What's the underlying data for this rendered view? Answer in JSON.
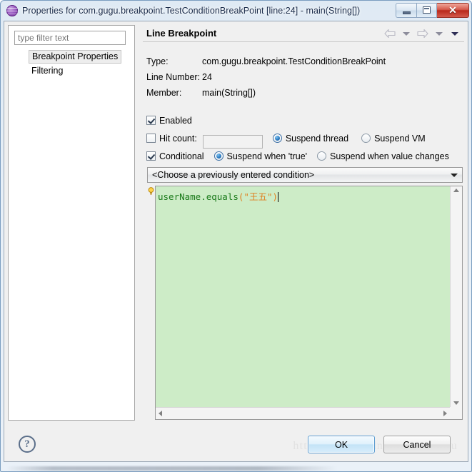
{
  "window": {
    "title": "Properties for com.gugu.breakpoint.TestConditionBreakPoint [line:24] - main(String[])",
    "icon": "eclipse-globe-icon",
    "buttons": {
      "minimize": "–",
      "maximize": "□",
      "close": "✕"
    }
  },
  "sidebar": {
    "filter": {
      "placeholder": "type filter text",
      "value": ""
    },
    "items": [
      {
        "label": "Breakpoint Properties",
        "selected": true
      },
      {
        "label": "Filtering",
        "selected": false
      }
    ]
  },
  "page": {
    "title": "Line Breakpoint",
    "nav": {
      "back": "back-arrow",
      "back_menu": "chevron-down",
      "forward": "forward-arrow",
      "forward_menu": "chevron-down",
      "view_menu": "chevron-down-filled"
    },
    "info": [
      {
        "label": "Type:",
        "value": "com.gugu.breakpoint.TestConditionBreakPoint"
      },
      {
        "label": "Line Number:",
        "value": "24"
      },
      {
        "label": "Member:",
        "value": "main(String[])"
      }
    ],
    "controls": {
      "enabled": {
        "label": "Enabled",
        "checked": true
      },
      "hit_count": {
        "label": "Hit count:",
        "checked": false,
        "value": ""
      },
      "suspend_thread": {
        "label": "Suspend thread",
        "selected": true
      },
      "suspend_vm": {
        "label": "Suspend VM",
        "selected": false
      },
      "conditional": {
        "label": "Conditional",
        "checked": true
      },
      "suspend_when_true": {
        "label": "Suspend when 'true'",
        "selected": true
      },
      "suspend_when_value_changes": {
        "label": "Suspend when value changes",
        "selected": false
      }
    },
    "condition_combo": {
      "value": "<Choose a previously entered condition>",
      "arrow": "chevron-down"
    },
    "editor": {
      "hint_icon": "lightbulb-icon",
      "code_tokens": [
        {
          "text": "userName.equals",
          "type": "id"
        },
        {
          "text": "(",
          "type": "punct"
        },
        {
          "text": "\"王五\"",
          "type": "str"
        },
        {
          "text": ")",
          "type": "punct"
        }
      ],
      "plain_code": "userName.equals(\"王五\")",
      "background": "#cdecc7"
    }
  },
  "footer": {
    "help": "?",
    "ok": "OK",
    "cancel": "Cancel",
    "watermark": "https://blog.csdn.net/zhazhagu"
  },
  "colors": {
    "titlebar_text": "#1b2c4a",
    "editor_bg": "#cdecc7",
    "code_identifier": "#1a7a1a",
    "code_punctuation": "#e08020",
    "radio_accent": "#2d7dc4",
    "ok_border": "#5a9bd0"
  }
}
